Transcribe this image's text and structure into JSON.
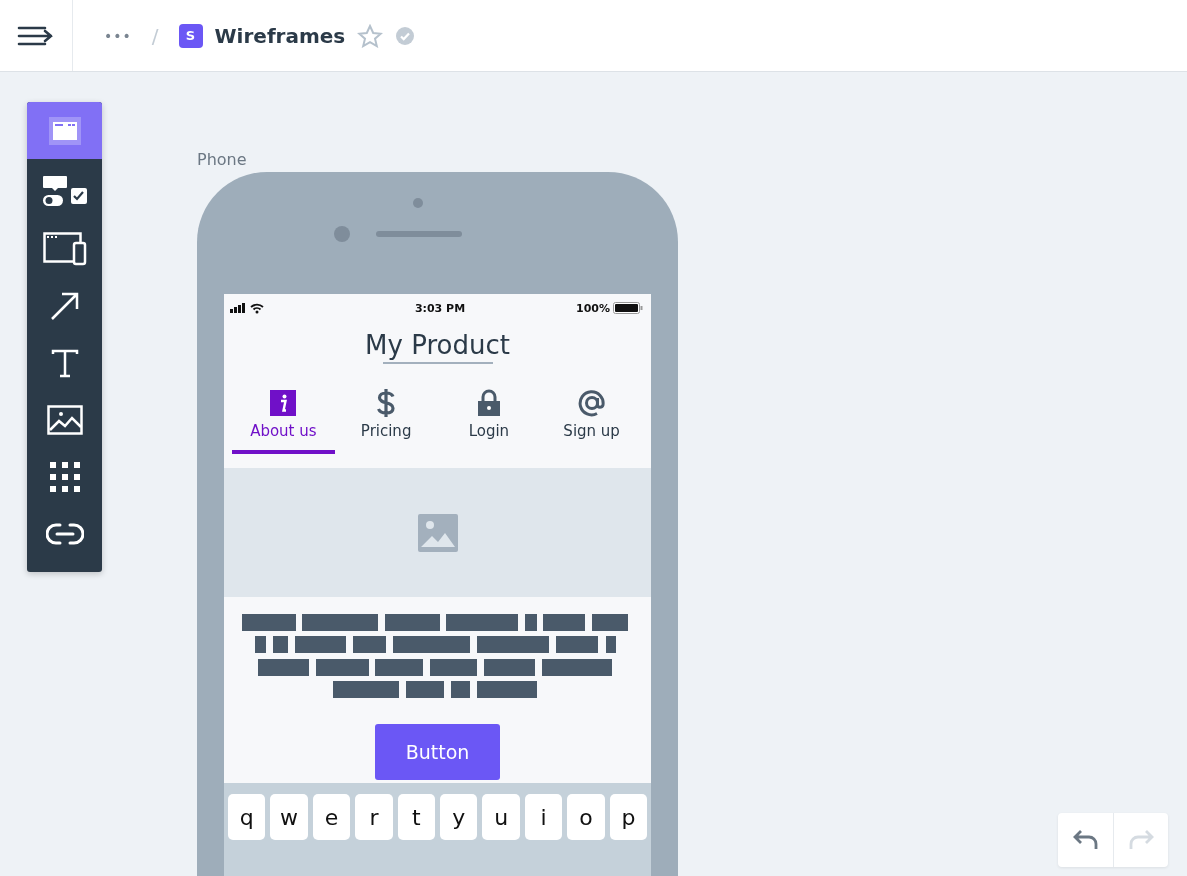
{
  "header": {
    "breadcrumb_more": "•••",
    "separator": "/",
    "project_badge": "S",
    "title": "Wireframes",
    "starred": false
  },
  "toolbar": {
    "items": [
      {
        "kind": "screen",
        "selected": true
      },
      {
        "kind": "controls",
        "selected": false
      },
      {
        "kind": "devices",
        "selected": false
      },
      {
        "kind": "arrow",
        "selected": false
      },
      {
        "kind": "text",
        "selected": false
      },
      {
        "kind": "image",
        "selected": false
      },
      {
        "kind": "grid",
        "selected": false
      },
      {
        "kind": "link",
        "selected": false
      }
    ]
  },
  "frame_label": "Phone",
  "phone": {
    "status_bar": {
      "time": "3:03 PM",
      "battery": "100%"
    },
    "app_title": "My Product",
    "tabs": [
      {
        "label": "About us",
        "kind": "info",
        "selected": true
      },
      {
        "label": "Pricing",
        "kind": "dollar",
        "selected": false
      },
      {
        "label": "Login",
        "kind": "lock",
        "selected": false
      },
      {
        "label": "Sign up",
        "kind": "at",
        "selected": false
      }
    ],
    "button": "Button",
    "keyboard": [
      "q",
      "w",
      "e",
      "r",
      "t",
      "y",
      "u",
      "i",
      "o",
      "p"
    ]
  },
  "history": {
    "undo_disabled": false,
    "redo_disabled": true
  }
}
